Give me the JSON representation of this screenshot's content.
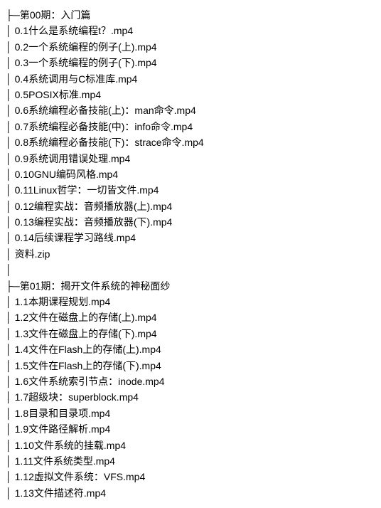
{
  "sections": [
    {
      "header_prefix": "├─",
      "header_text": "第00期：入门篇",
      "items": [
        {
          "prefix": "│        ",
          "name": "0.1什么是系统编程t？.mp4"
        },
        {
          "prefix": "│        ",
          "name": "0.2一个系统编程的例子(上).mp4"
        },
        {
          "prefix": "│        ",
          "name": "0.3一个系统编程的例子(下).mp4"
        },
        {
          "prefix": "│        ",
          "name": "0.4系统调用与C标准库.mp4"
        },
        {
          "prefix": "│        ",
          "name": "0.5POSIX标准.mp4"
        },
        {
          "prefix": "│        ",
          "name": "0.6系统编程必备技能(上)：man命令.mp4"
        },
        {
          "prefix": "│        ",
          "name": "0.7系统编程必备技能(中)：info命令.mp4"
        },
        {
          "prefix": "│        ",
          "name": "0.8系统编程必备技能(下)：strace命令.mp4"
        },
        {
          "prefix": "│        ",
          "name": "0.9系统调用错误处理.mp4"
        },
        {
          "prefix": "│        ",
          "name": "0.10GNU编码风格.mp4"
        },
        {
          "prefix": "│        ",
          "name": "0.11Linux哲学：一切皆文件.mp4"
        },
        {
          "prefix": "│        ",
          "name": "0.12编程实战：音频播放器(上).mp4"
        },
        {
          "prefix": "│        ",
          "name": "0.13编程实战：音频播放器(下).mp4"
        },
        {
          "prefix": "│        ",
          "name": "0.14后续课程学习路线.mp4"
        },
        {
          "prefix": "│        ",
          "name": "资料.zip"
        }
      ]
    },
    {
      "header_prefix": "├─",
      "header_text": "第01期：揭开文件系统的神秘面纱",
      "items": [
        {
          "prefix": "│        ",
          "name": "1.1本期课程规划.mp4"
        },
        {
          "prefix": "│        ",
          "name": "1.2文件在磁盘上的存储(上).mp4"
        },
        {
          "prefix": "│        ",
          "name": "1.3文件在磁盘上的存储(下).mp4"
        },
        {
          "prefix": "│        ",
          "name": "1.4文件在Flash上的存储(上).mp4"
        },
        {
          "prefix": "│        ",
          "name": "1.5文件在Flash上的存储(下).mp4"
        },
        {
          "prefix": "│        ",
          "name": "1.6文件系统索引节点：inode.mp4"
        },
        {
          "prefix": "│        ",
          "name": "1.7超级块：superblock.mp4"
        },
        {
          "prefix": "│        ",
          "name": "1.8目录和目录项.mp4"
        },
        {
          "prefix": "│        ",
          "name": "1.9文件路径解析.mp4"
        },
        {
          "prefix": "│        ",
          "name": "1.10文件系统的挂载.mp4"
        },
        {
          "prefix": "│        ",
          "name": "1.11文件系统类型.mp4"
        },
        {
          "prefix": "│        ",
          "name": "1.12虚拟文件系统：VFS.mp4"
        },
        {
          "prefix": "│        ",
          "name": "1.13文件描述符.mp4"
        }
      ]
    }
  ]
}
